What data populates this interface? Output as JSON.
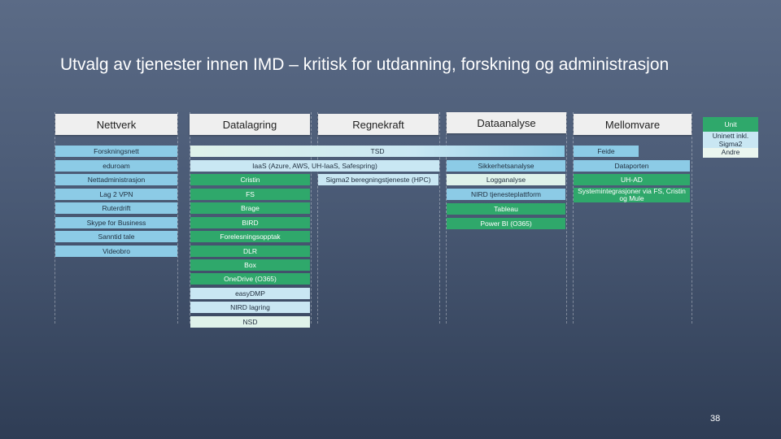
{
  "title": "Utvalg av tjenester innen IMD – kritisk for utdanning, forskning og administrasjon",
  "columns": {
    "nettverk": "Nettverk",
    "datalagring": "Datalagring",
    "regnekraft": "Regnekraft",
    "dataanalyse": "Dataanalyse",
    "mellomvare": "Mellomvare",
    "unit": "Unit\nUninett inkl. Sigma2\nAndre"
  },
  "nettverk_items": [
    "Forskningsnett",
    "eduroam",
    "Nettadministrasjon",
    "Lag 2 VPN",
    "Ruterdrift",
    "Skype for Business",
    "Sanntid tale",
    "Videobro"
  ],
  "tsd": "TSD",
  "feide": "Feide",
  "iaas": "IaaS (Azure, AWS, UH-IaaS, Safespring)",
  "sikkerhetsanalyse": "Sikkerhetsanalyse",
  "dataporten": "Dataporten",
  "cristin": "Cristin",
  "sigma2": "Sigma2 beregningstjeneste (HPC)",
  "logganalyse": "Logganalyse",
  "uh_ad": "UH-AD",
  "fs": "FS",
  "nird_plattform": "NIRD tjenesteplattform",
  "systemintegrasjoner": "Systemintegrasjoner via FS, Cristin og Mule",
  "brage": "Brage",
  "tableau": "Tableau",
  "bird": "BIRD",
  "powerbi": "Power BI (O365)",
  "forelesningsopptak": "Forelesningsopptak",
  "dlr": "DLR",
  "box": "Box",
  "onedrive": "OneDrive (O365)",
  "easydmp": "easyDMP",
  "nird_lagring": "NIRD lagring",
  "nsd": "NSD",
  "page_number": "38"
}
